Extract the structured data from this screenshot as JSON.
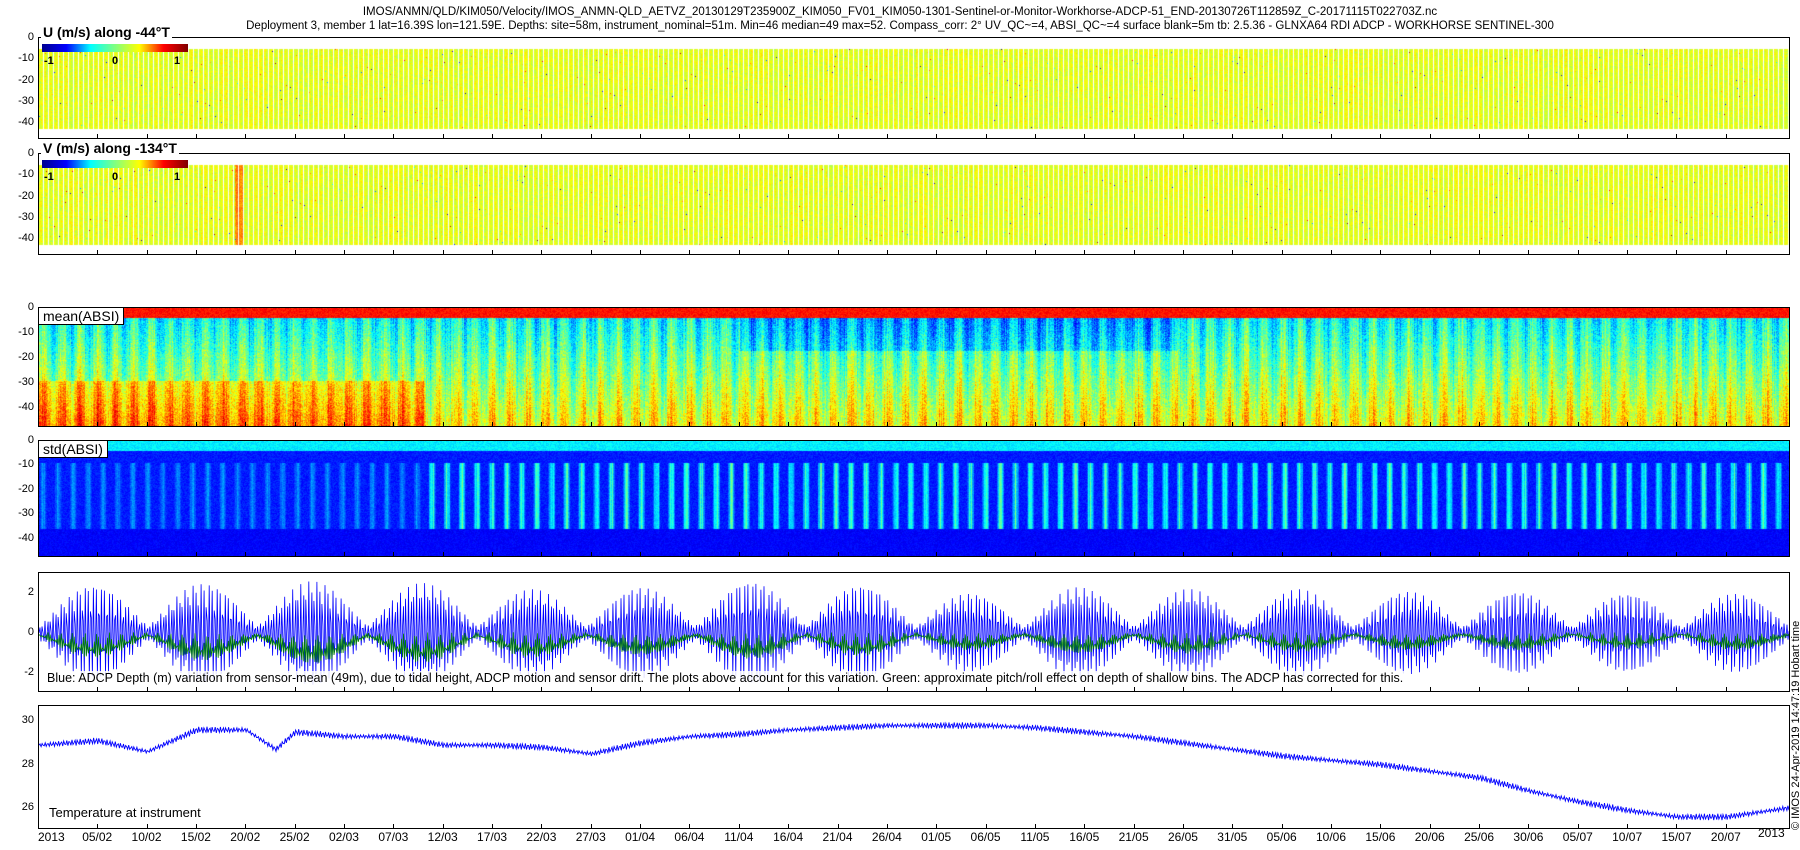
{
  "figure": {
    "title_line1": "IMOS/ANMN/QLD/KIM050/Velocity/IMOS_ANMN-QLD_AETVZ_20130129T235900Z_KIM050_FV01_KIM050-1301-Sentinel-or-Monitor-Workhorse-ADCP-51_END-20130726T112859Z_C-20171115T022703Z.nc",
    "title_line2": "Deployment 3, member 1 lat=16.39S lon=121.59E. Depths: site=58m, instrument_nominal=51m. Min=46 median=49 max=52. Compass_corr: 2° UV_QC~=4, ABSI_QC~=4 surface blank=5m tb: 2.5.36 - GLNXA64 RDI ADCP - WORKHORSE SENTINEL-300",
    "side_label": "© IMOS 24-Apr-2019 14:47:19 Hobart time",
    "time_zone_label": "Hobart time"
  },
  "chart_data": [
    {
      "type": "heatmap",
      "title": "U (m/s) along -44°T",
      "colorbar_ticks": [
        "-1",
        "0",
        "1"
      ],
      "clim": [
        -1,
        1
      ],
      "y_ticks": [
        "0",
        "-10",
        "-20",
        "-30",
        "-40"
      ],
      "ylim": [
        -48,
        0
      ],
      "depth_range_with_data": [
        -43,
        -5
      ],
      "dominant_value": 0,
      "colormap": "jet"
    },
    {
      "type": "heatmap",
      "title": "V (m/s) along -134°T",
      "colorbar_ticks": [
        "-1",
        "0",
        "1"
      ],
      "clim": [
        -1,
        1
      ],
      "y_ticks": [
        "0",
        "-10",
        "-20",
        "-30",
        "-40"
      ],
      "ylim": [
        -48,
        0
      ],
      "depth_range_with_data": [
        -43,
        -5
      ],
      "dominant_value": 0,
      "colormap": "jet"
    },
    {
      "type": "heatmap",
      "title": "mean(ABSI)",
      "y_ticks": [
        "0",
        "-10",
        "-20",
        "-30",
        "-40"
      ],
      "ylim": [
        -48,
        0
      ],
      "colormap": "jet"
    },
    {
      "type": "heatmap",
      "title": "std(ABSI)",
      "y_ticks": [
        "0",
        "-10",
        "-20",
        "-30",
        "-40"
      ],
      "ylim": [
        -48,
        0
      ],
      "colormap": "jet"
    },
    {
      "type": "line",
      "y_ticks": [
        "2",
        "0",
        "-2"
      ],
      "ylim": [
        -3,
        3
      ],
      "annotation": "Blue: ADCP Depth (m) variation from sensor-mean (49m), due to tidal height, ADCP motion and sensor drift. The plots above account for this variation. Green: approximate pitch/roll effect on depth of shallow bins. The ADCP has corrected for this.",
      "series": [
        {
          "color": "#0000ff",
          "envelope_peaks": [
            2.4,
            2.5,
            2.6,
            2.5,
            2.2,
            2.3,
            2.6,
            2.4,
            2.0,
            2.3,
            2.2,
            2.2,
            2.1,
            2.1,
            2.0,
            2.0
          ]
        },
        {
          "color": "#008000",
          "envelope_peaks": [
            1.4,
            1.6,
            1.8,
            1.7,
            1.4,
            1.3,
            1.5,
            1.3,
            1.0,
            1.2,
            1.2,
            1.1,
            1.0,
            1.0,
            0.9,
            1.0
          ]
        }
      ]
    },
    {
      "type": "line",
      "annotation": "Temperature at instrument",
      "y_ticks": [
        "30",
        "28",
        "26"
      ],
      "ylim": [
        25,
        30.7
      ],
      "x": [
        "2013-01-30",
        "2013-02-05",
        "2013-02-10",
        "2013-02-15",
        "2013-02-20",
        "2013-02-23",
        "2013-02-25",
        "2013-03-02",
        "2013-03-07",
        "2013-03-12",
        "2013-03-17",
        "2013-03-22",
        "2013-03-27",
        "2013-04-01",
        "2013-04-06",
        "2013-04-11",
        "2013-04-16",
        "2013-04-21",
        "2013-04-26",
        "2013-05-01",
        "2013-05-06",
        "2013-05-11",
        "2013-05-16",
        "2013-05-21",
        "2013-05-26",
        "2013-05-31",
        "2013-06-05",
        "2013-06-10",
        "2013-06-15",
        "2013-06-20",
        "2013-06-25",
        "2013-06-30",
        "2013-07-05",
        "2013-07-10",
        "2013-07-15",
        "2013-07-20",
        "2013-07-26"
      ],
      "y": [
        28.9,
        29.1,
        28.6,
        29.6,
        29.6,
        28.7,
        29.5,
        29.3,
        29.3,
        28.9,
        28.9,
        28.8,
        28.5,
        29.0,
        29.3,
        29.4,
        29.6,
        29.7,
        29.8,
        29.8,
        29.8,
        29.7,
        29.5,
        29.3,
        29.0,
        28.7,
        28.4,
        28.2,
        28.0,
        27.7,
        27.4,
        26.8,
        26.3,
        25.9,
        25.6,
        25.6,
        26.0
      ],
      "tidal_ripple_amplitude": 0.15,
      "color": "#0000ff"
    }
  ],
  "x_axis": {
    "year_label_left": "2013",
    "year_label_right": "2013",
    "tick_labels": [
      "05/02",
      "10/02",
      "15/02",
      "20/02",
      "25/02",
      "02/03",
      "07/03",
      "12/03",
      "17/03",
      "22/03",
      "27/03",
      "01/04",
      "06/04",
      "11/04",
      "16/04",
      "21/04",
      "26/04",
      "01/05",
      "06/05",
      "11/05",
      "16/05",
      "21/05",
      "26/05",
      "31/05",
      "05/06",
      "10/06",
      "15/06",
      "20/06",
      "25/06",
      "30/06",
      "05/07",
      "10/07",
      "15/07",
      "20/07"
    ],
    "start": "2013-01-30",
    "end": "2013-07-26"
  }
}
